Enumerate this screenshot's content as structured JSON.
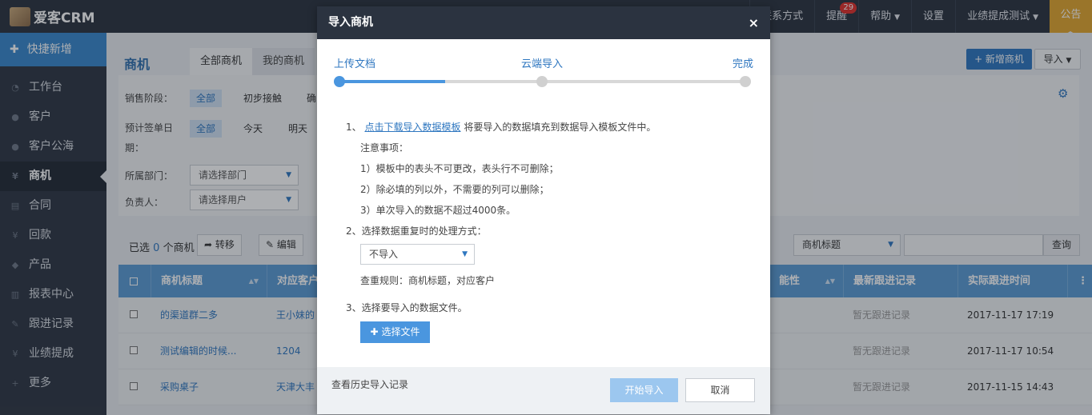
{
  "topbar": {
    "brand": "爱客CRM",
    "nav": [
      {
        "label": "联系方式",
        "has_caret": false
      },
      {
        "label": "提醒",
        "badge": "29",
        "has_caret": false
      },
      {
        "label": "帮助",
        "has_caret": true
      },
      {
        "label": "设置",
        "has_caret": false
      },
      {
        "label": "业绩提成测试",
        "has_caret": true
      }
    ],
    "notice": "公告"
  },
  "sidebar": {
    "quick_add": "快捷新增",
    "items": [
      {
        "label": "工作台",
        "icon": "dashboard-icon",
        "glyph": "◔"
      },
      {
        "label": "客户",
        "icon": "users-icon",
        "glyph": "●"
      },
      {
        "label": "客户公海",
        "icon": "users-icon",
        "glyph": "●"
      },
      {
        "label": "商机",
        "icon": "yen-icon",
        "glyph": "¥",
        "active": true
      },
      {
        "label": "合同",
        "icon": "document-icon",
        "glyph": "▤"
      },
      {
        "label": "回款",
        "icon": "yen-icon",
        "glyph": "¥"
      },
      {
        "label": "产品",
        "icon": "tag-icon",
        "glyph": "◆"
      },
      {
        "label": "报表中心",
        "icon": "chart-icon",
        "glyph": "▥"
      },
      {
        "label": "跟进记录",
        "icon": "edit-icon",
        "glyph": "✎"
      },
      {
        "label": "业绩提成",
        "icon": "yen-icon",
        "glyph": "¥"
      },
      {
        "label": "更多",
        "icon": "plus-icon",
        "glyph": "+"
      }
    ]
  },
  "main": {
    "title": "商机",
    "tabs": [
      "全部商机",
      "我的商机"
    ],
    "new_button": "+ 新增商机",
    "import_button": "导入",
    "filters": {
      "stage_label": "销售阶段：",
      "stage_options": [
        "全部",
        "初步接触",
        "确"
      ],
      "date_label": "预计签单日",
      "date_label_2": "期：",
      "date_options": [
        "全部",
        "今天",
        "明天"
      ],
      "dept_label": "所属部门：",
      "dept_placeholder": "请选择部门",
      "owner_label": "负责人：",
      "owner_placeholder": "请选择用户"
    },
    "toolbar": {
      "selected_prefix": "已选",
      "selected_count": "0",
      "selected_suffix": "个商机",
      "transfer": "转移",
      "edit": "编辑",
      "search_field": "商机标题",
      "search_button": "查询"
    },
    "table": {
      "headers": [
        "商机标题",
        "对应客户",
        "能性",
        "最新跟进记录",
        "实际跟进时间"
      ],
      "rows": [
        {
          "title": "的渠道群二多",
          "customer": "王小妹的",
          "latest": "暂无跟进记录",
          "time": "2017-11-17 17:19"
        },
        {
          "title": "测试编辑的时候...",
          "customer": "1204",
          "latest": "暂无跟进记录",
          "time": "2017-11-17 10:54"
        },
        {
          "title": "采购桌子",
          "customer": "天津大丰",
          "latest": "暂无跟进记录",
          "time": "2017-11-15 14:43"
        }
      ]
    }
  },
  "modal": {
    "title": "导入商机",
    "close": "×",
    "steps": [
      "上传文档",
      "云端导入",
      "完成"
    ],
    "progress": 0.26,
    "step1_prefix": "1、",
    "download_link": "点击下载导入数据模板",
    "step1_text": "将要导入的数据填充到数据导入模板文件中。",
    "notes_title": "注意事项：",
    "notes": [
      "1）模板中的表头不可更改，表头行不可删除；",
      "2）除必填的列以外，不需要的列可以删除；",
      "3）单次导入的数据不超过4000条。"
    ],
    "step2": "2、选择数据重复时的处理方式：",
    "dup_select": "不导入",
    "dup_rule": "查重规则：商机标题，对应客户",
    "step3": "3、选择要导入的数据文件。",
    "choose_file": "选择文件",
    "history": "查看历史导入记录",
    "start": "开始导入",
    "cancel": "取消"
  },
  "colors": {
    "accent": "#2f77c0",
    "topbar": "#2b3340",
    "notice": "#e2a72e",
    "table_head": "#5b9bd5"
  }
}
